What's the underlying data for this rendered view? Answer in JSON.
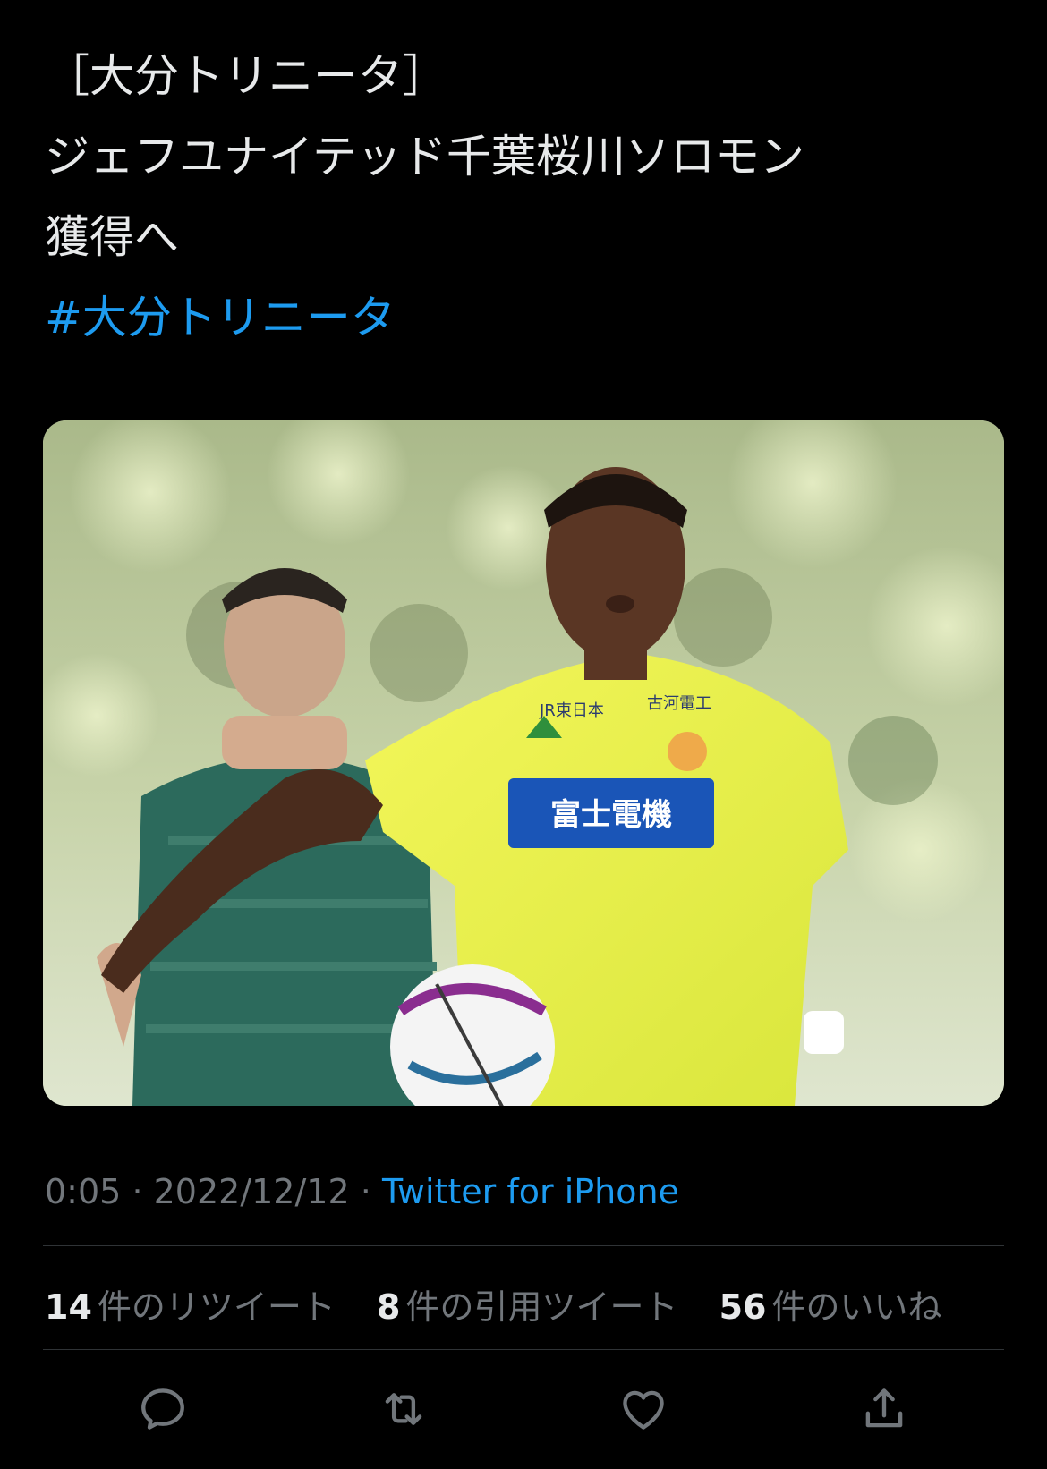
{
  "tweet": {
    "text_line1": "［大分トリニータ］",
    "text_line2": "ジェフユナイテッド千葉桜川ソロモン",
    "text_line3": "獲得へ",
    "hashtag": "#大分トリニータ"
  },
  "media": {
    "jersey_sponsor_main": "富士電機",
    "jersey_sponsor_chest": "JR東日本",
    "jersey_sponsor_right": "古河電工"
  },
  "meta": {
    "time": "0:05",
    "separator": "·",
    "date": "2022/12/12",
    "source": "Twitter for iPhone"
  },
  "stats": {
    "retweets_count": "14",
    "retweets_label": "件のリツイート",
    "quotes_count": "8",
    "quotes_label": "件の引用ツイート",
    "likes_count": "56",
    "likes_label": "件のいいね"
  },
  "actions": {
    "reply_icon": "reply-icon",
    "retweet_icon": "retweet-icon",
    "like_icon": "heart-icon",
    "share_icon": "share-icon"
  },
  "colors": {
    "background": "#000000",
    "text": "#e7e9ea",
    "muted": "#71767b",
    "link": "#1d9bf0",
    "divider": "#2f3336"
  }
}
